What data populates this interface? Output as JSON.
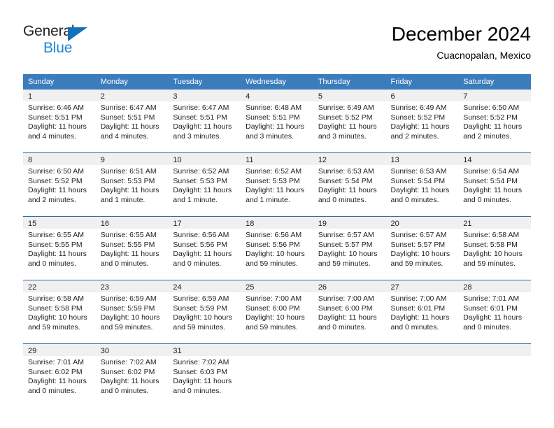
{
  "brand": {
    "name_part1": "General",
    "name_part2": "Blue",
    "triangle_icon": "triangle-icon",
    "accent_color": "#1c87d6"
  },
  "header": {
    "title": "December 2024",
    "subtitle": "Cuacnopalan, Mexico"
  },
  "theme": {
    "header_row_bg": "#3b7cbd",
    "day_band_bg": "#f0f0f0",
    "divider_color": "#2e6da4",
    "text_color": "#222222"
  },
  "weekdays": [
    "Sunday",
    "Monday",
    "Tuesday",
    "Wednesday",
    "Thursday",
    "Friday",
    "Saturday"
  ],
  "weeks": [
    [
      {
        "day": "1",
        "sunrise": "Sunrise: 6:46 AM",
        "sunset": "Sunset: 5:51 PM",
        "daylight1": "Daylight: 11 hours",
        "daylight2": "and 4 minutes."
      },
      {
        "day": "2",
        "sunrise": "Sunrise: 6:47 AM",
        "sunset": "Sunset: 5:51 PM",
        "daylight1": "Daylight: 11 hours",
        "daylight2": "and 4 minutes."
      },
      {
        "day": "3",
        "sunrise": "Sunrise: 6:47 AM",
        "sunset": "Sunset: 5:51 PM",
        "daylight1": "Daylight: 11 hours",
        "daylight2": "and 3 minutes."
      },
      {
        "day": "4",
        "sunrise": "Sunrise: 6:48 AM",
        "sunset": "Sunset: 5:51 PM",
        "daylight1": "Daylight: 11 hours",
        "daylight2": "and 3 minutes."
      },
      {
        "day": "5",
        "sunrise": "Sunrise: 6:49 AM",
        "sunset": "Sunset: 5:52 PM",
        "daylight1": "Daylight: 11 hours",
        "daylight2": "and 3 minutes."
      },
      {
        "day": "6",
        "sunrise": "Sunrise: 6:49 AM",
        "sunset": "Sunset: 5:52 PM",
        "daylight1": "Daylight: 11 hours",
        "daylight2": "and 2 minutes."
      },
      {
        "day": "7",
        "sunrise": "Sunrise: 6:50 AM",
        "sunset": "Sunset: 5:52 PM",
        "daylight1": "Daylight: 11 hours",
        "daylight2": "and 2 minutes."
      }
    ],
    [
      {
        "day": "8",
        "sunrise": "Sunrise: 6:50 AM",
        "sunset": "Sunset: 5:52 PM",
        "daylight1": "Daylight: 11 hours",
        "daylight2": "and 2 minutes."
      },
      {
        "day": "9",
        "sunrise": "Sunrise: 6:51 AM",
        "sunset": "Sunset: 5:53 PM",
        "daylight1": "Daylight: 11 hours",
        "daylight2": "and 1 minute."
      },
      {
        "day": "10",
        "sunrise": "Sunrise: 6:52 AM",
        "sunset": "Sunset: 5:53 PM",
        "daylight1": "Daylight: 11 hours",
        "daylight2": "and 1 minute."
      },
      {
        "day": "11",
        "sunrise": "Sunrise: 6:52 AM",
        "sunset": "Sunset: 5:53 PM",
        "daylight1": "Daylight: 11 hours",
        "daylight2": "and 1 minute."
      },
      {
        "day": "12",
        "sunrise": "Sunrise: 6:53 AM",
        "sunset": "Sunset: 5:54 PM",
        "daylight1": "Daylight: 11 hours",
        "daylight2": "and 0 minutes."
      },
      {
        "day": "13",
        "sunrise": "Sunrise: 6:53 AM",
        "sunset": "Sunset: 5:54 PM",
        "daylight1": "Daylight: 11 hours",
        "daylight2": "and 0 minutes."
      },
      {
        "day": "14",
        "sunrise": "Sunrise: 6:54 AM",
        "sunset": "Sunset: 5:54 PM",
        "daylight1": "Daylight: 11 hours",
        "daylight2": "and 0 minutes."
      }
    ],
    [
      {
        "day": "15",
        "sunrise": "Sunrise: 6:55 AM",
        "sunset": "Sunset: 5:55 PM",
        "daylight1": "Daylight: 11 hours",
        "daylight2": "and 0 minutes."
      },
      {
        "day": "16",
        "sunrise": "Sunrise: 6:55 AM",
        "sunset": "Sunset: 5:55 PM",
        "daylight1": "Daylight: 11 hours",
        "daylight2": "and 0 minutes."
      },
      {
        "day": "17",
        "sunrise": "Sunrise: 6:56 AM",
        "sunset": "Sunset: 5:56 PM",
        "daylight1": "Daylight: 11 hours",
        "daylight2": "and 0 minutes."
      },
      {
        "day": "18",
        "sunrise": "Sunrise: 6:56 AM",
        "sunset": "Sunset: 5:56 PM",
        "daylight1": "Daylight: 10 hours",
        "daylight2": "and 59 minutes."
      },
      {
        "day": "19",
        "sunrise": "Sunrise: 6:57 AM",
        "sunset": "Sunset: 5:57 PM",
        "daylight1": "Daylight: 10 hours",
        "daylight2": "and 59 minutes."
      },
      {
        "day": "20",
        "sunrise": "Sunrise: 6:57 AM",
        "sunset": "Sunset: 5:57 PM",
        "daylight1": "Daylight: 10 hours",
        "daylight2": "and 59 minutes."
      },
      {
        "day": "21",
        "sunrise": "Sunrise: 6:58 AM",
        "sunset": "Sunset: 5:58 PM",
        "daylight1": "Daylight: 10 hours",
        "daylight2": "and 59 minutes."
      }
    ],
    [
      {
        "day": "22",
        "sunrise": "Sunrise: 6:58 AM",
        "sunset": "Sunset: 5:58 PM",
        "daylight1": "Daylight: 10 hours",
        "daylight2": "and 59 minutes."
      },
      {
        "day": "23",
        "sunrise": "Sunrise: 6:59 AM",
        "sunset": "Sunset: 5:59 PM",
        "daylight1": "Daylight: 10 hours",
        "daylight2": "and 59 minutes."
      },
      {
        "day": "24",
        "sunrise": "Sunrise: 6:59 AM",
        "sunset": "Sunset: 5:59 PM",
        "daylight1": "Daylight: 10 hours",
        "daylight2": "and 59 minutes."
      },
      {
        "day": "25",
        "sunrise": "Sunrise: 7:00 AM",
        "sunset": "Sunset: 6:00 PM",
        "daylight1": "Daylight: 10 hours",
        "daylight2": "and 59 minutes."
      },
      {
        "day": "26",
        "sunrise": "Sunrise: 7:00 AM",
        "sunset": "Sunset: 6:00 PM",
        "daylight1": "Daylight: 11 hours",
        "daylight2": "and 0 minutes."
      },
      {
        "day": "27",
        "sunrise": "Sunrise: 7:00 AM",
        "sunset": "Sunset: 6:01 PM",
        "daylight1": "Daylight: 11 hours",
        "daylight2": "and 0 minutes."
      },
      {
        "day": "28",
        "sunrise": "Sunrise: 7:01 AM",
        "sunset": "Sunset: 6:01 PM",
        "daylight1": "Daylight: 11 hours",
        "daylight2": "and 0 minutes."
      }
    ],
    [
      {
        "day": "29",
        "sunrise": "Sunrise: 7:01 AM",
        "sunset": "Sunset: 6:02 PM",
        "daylight1": "Daylight: 11 hours",
        "daylight2": "and 0 minutes."
      },
      {
        "day": "30",
        "sunrise": "Sunrise: 7:02 AM",
        "sunset": "Sunset: 6:02 PM",
        "daylight1": "Daylight: 11 hours",
        "daylight2": "and 0 minutes."
      },
      {
        "day": "31",
        "sunrise": "Sunrise: 7:02 AM",
        "sunset": "Sunset: 6:03 PM",
        "daylight1": "Daylight: 11 hours",
        "daylight2": "and 0 minutes."
      },
      {
        "day": "",
        "sunrise": "",
        "sunset": "",
        "daylight1": "",
        "daylight2": ""
      },
      {
        "day": "",
        "sunrise": "",
        "sunset": "",
        "daylight1": "",
        "daylight2": ""
      },
      {
        "day": "",
        "sunrise": "",
        "sunset": "",
        "daylight1": "",
        "daylight2": ""
      },
      {
        "day": "",
        "sunrise": "",
        "sunset": "",
        "daylight1": "",
        "daylight2": ""
      }
    ]
  ]
}
